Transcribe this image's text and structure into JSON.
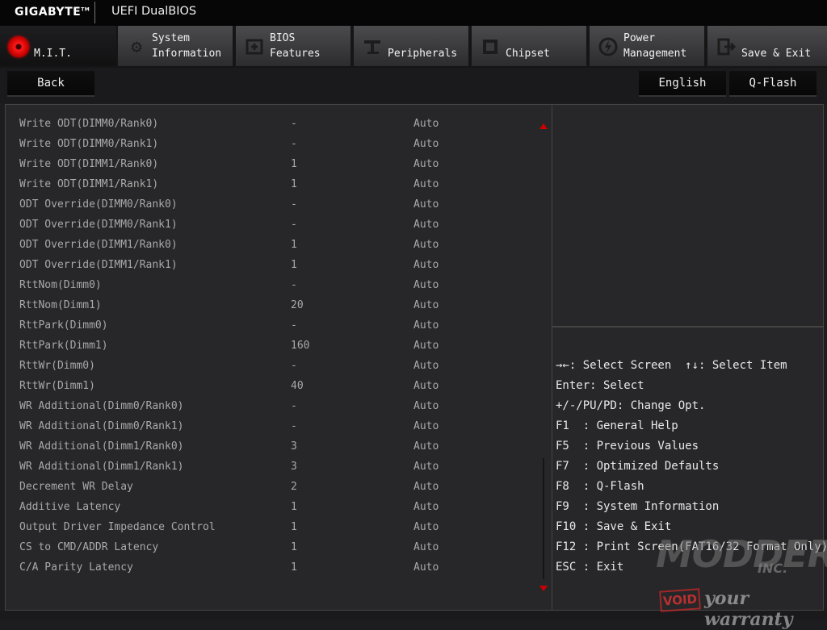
{
  "header": {
    "brand": "GIGABYTE",
    "brand_tm": "TM",
    "app_title": "UEFI DualBIOS"
  },
  "tabs": [
    {
      "label": "M.I.T.",
      "icon": "mit-red-dot-icon",
      "active": true
    },
    {
      "label": "System\nInformation",
      "icon": "gear-icon",
      "active": false
    },
    {
      "label": "BIOS\nFeatures",
      "icon": "bios-chip-icon",
      "active": false
    },
    {
      "label": "Peripherals",
      "icon": "peripherals-icon",
      "active": false
    },
    {
      "label": "Chipset",
      "icon": "chipset-icon",
      "active": false
    },
    {
      "label": "Power\nManagement",
      "icon": "power-icon",
      "active": false
    },
    {
      "label": "Save & Exit",
      "icon": "exit-icon",
      "active": false
    }
  ],
  "buttons": {
    "back": "Back",
    "language": "English",
    "qflash": "Q-Flash"
  },
  "settings": [
    {
      "name": "Write ODT(DIMM0/Rank0)",
      "current": "-",
      "value": "Auto"
    },
    {
      "name": "Write ODT(DIMM0/Rank1)",
      "current": "-",
      "value": "Auto"
    },
    {
      "name": "Write ODT(DIMM1/Rank0)",
      "current": "1",
      "value": "Auto"
    },
    {
      "name": "Write ODT(DIMM1/Rank1)",
      "current": "1",
      "value": "Auto"
    },
    {
      "name": "ODT Override(DIMM0/Rank0)",
      "current": "-",
      "value": "Auto"
    },
    {
      "name": "ODT Override(DIMM0/Rank1)",
      "current": "-",
      "value": "Auto"
    },
    {
      "name": "ODT Override(DIMM1/Rank0)",
      "current": "1",
      "value": "Auto"
    },
    {
      "name": "ODT Override(DIMM1/Rank1)",
      "current": "1",
      "value": "Auto"
    },
    {
      "name": "RttNom(Dimm0)",
      "current": "-",
      "value": "Auto"
    },
    {
      "name": "RttNom(Dimm1)",
      "current": "20",
      "value": "Auto"
    },
    {
      "name": "RttPark(Dimm0)",
      "current": "-",
      "value": "Auto"
    },
    {
      "name": "RttPark(Dimm1)",
      "current": "160",
      "value": "Auto"
    },
    {
      "name": "RttWr(Dimm0)",
      "current": "-",
      "value": "Auto"
    },
    {
      "name": "RttWr(Dimm1)",
      "current": "40",
      "value": "Auto"
    },
    {
      "name": "WR Additional(Dimm0/Rank0)",
      "current": "-",
      "value": "Auto"
    },
    {
      "name": "WR Additional(Dimm0/Rank1)",
      "current": "-",
      "value": "Auto"
    },
    {
      "name": "WR Additional(Dimm1/Rank0)",
      "current": "3",
      "value": "Auto"
    },
    {
      "name": "WR Additional(Dimm1/Rank1)",
      "current": "3",
      "value": "Auto"
    },
    {
      "name": "Decrement WR Delay",
      "current": "2",
      "value": "Auto"
    },
    {
      "name": "Additive Latency",
      "current": "1",
      "value": "Auto"
    },
    {
      "name": "Output Driver Impedance Control",
      "current": "1",
      "value": "Auto"
    },
    {
      "name": "CS to CMD/ADDR Latency",
      "current": "1",
      "value": "Auto"
    },
    {
      "name": "C/A Parity Latency",
      "current": "1",
      "value": "Auto"
    }
  ],
  "help": [
    "→←: Select Screen  ↑↓: Select Item",
    "Enter: Select",
    "+/-/PU/PD: Change Opt.",
    "F1  : General Help",
    "F5  : Previous Values",
    "F7  : Optimized Defaults",
    "F8  : Q-Flash",
    "F9  : System Information",
    "F10 : Save & Exit",
    "F12 : Print Screen(FAT16/32 Format Only)",
    "ESC : Exit"
  ],
  "watermark": {
    "brand": "MODDERS",
    "inc": "INC.",
    "void": "VOID",
    "tagline": "your warranty"
  },
  "colors": {
    "accent_red": "#cc0000",
    "panel_bg": "#272729",
    "text_dim": "#a9a9a9"
  }
}
